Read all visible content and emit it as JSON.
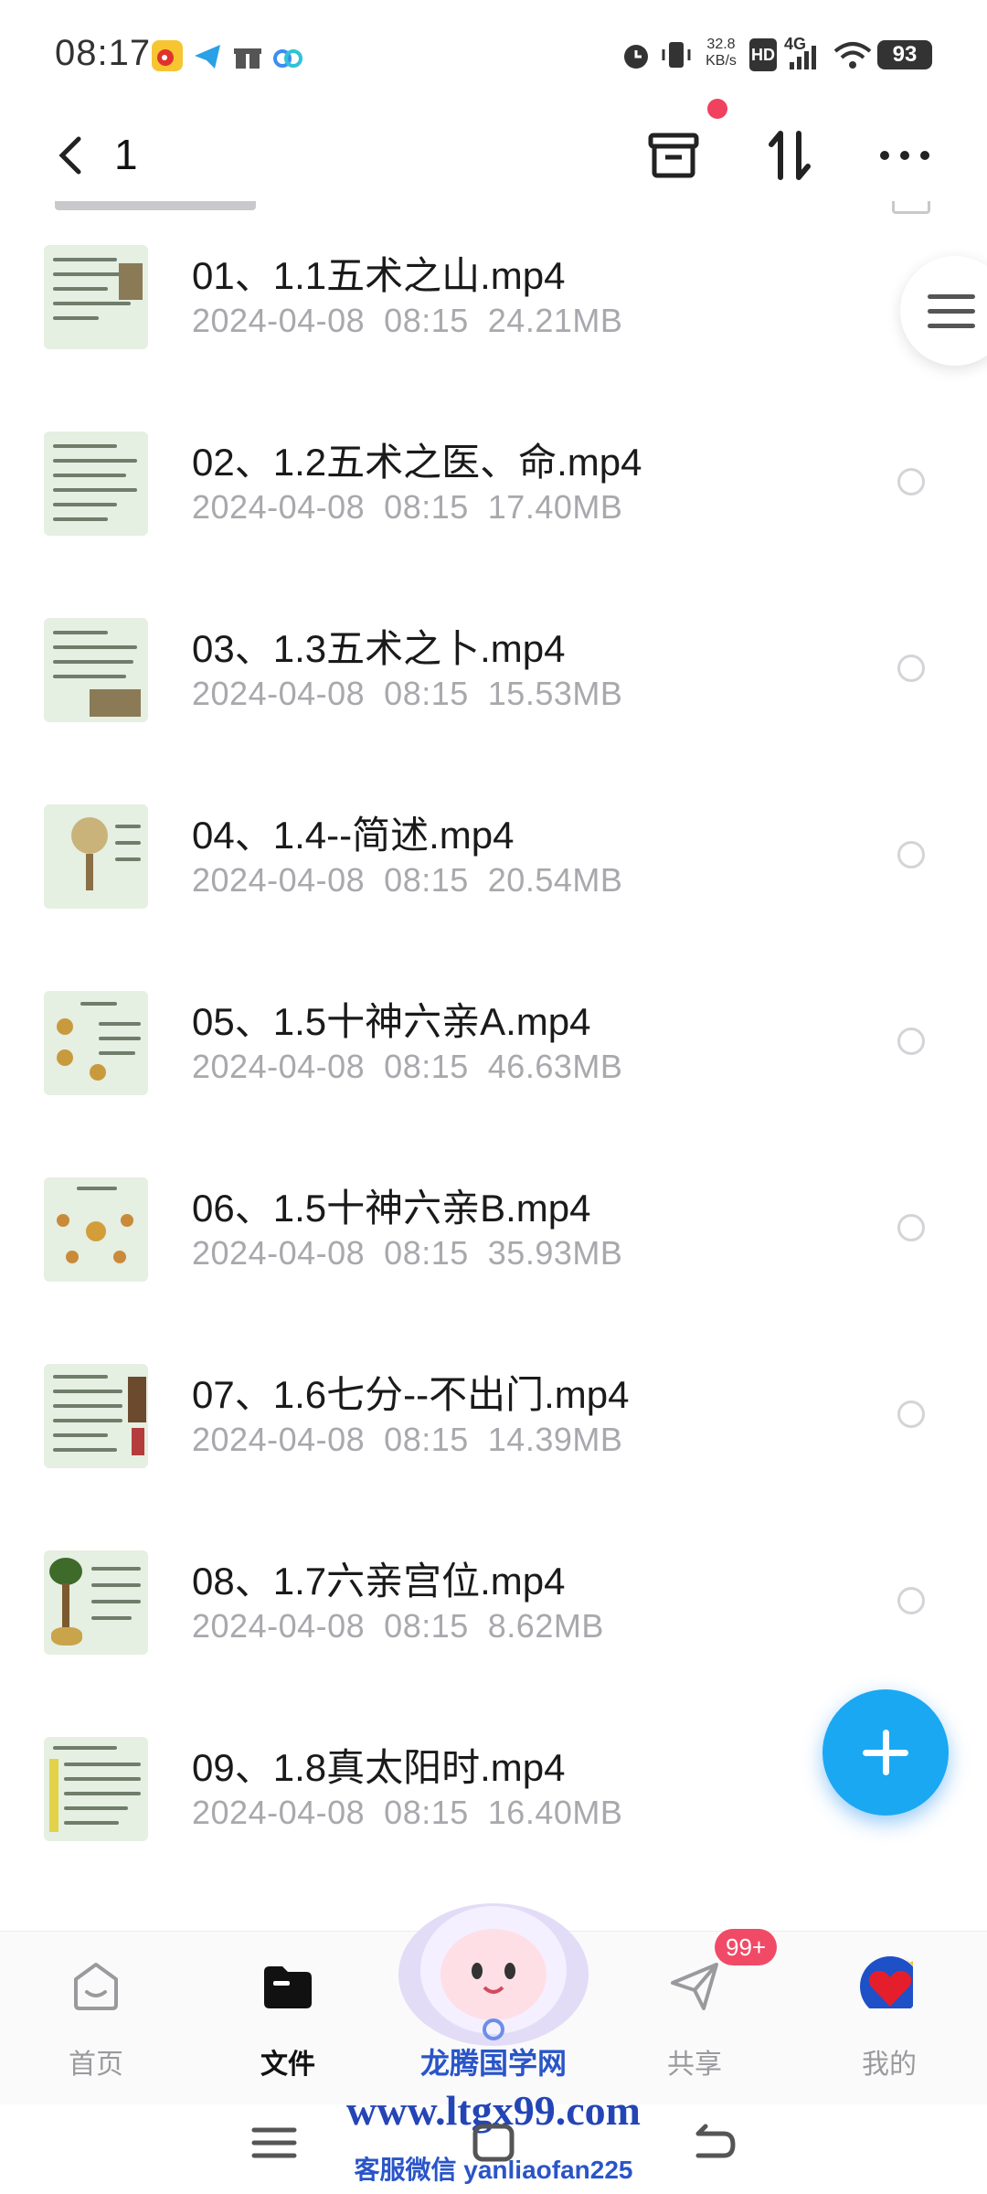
{
  "status_bar": {
    "time": "08:17",
    "net_speed_value": "32.8",
    "net_speed_unit": "KB/s",
    "hd_label": "HD",
    "network_label": "4G",
    "battery": "93"
  },
  "header": {
    "back_label": "<",
    "title": "1"
  },
  "files": [
    {
      "name": "01、1.1五术之山.mp4",
      "date": "2024-04-08",
      "time": "08:15",
      "size": "24.21MB"
    },
    {
      "name": "02、1.2五术之医、命.mp4",
      "date": "2024-04-08",
      "time": "08:15",
      "size": "17.40MB"
    },
    {
      "name": "03、1.3五术之卜.mp4",
      "date": "2024-04-08",
      "time": "08:15",
      "size": "15.53MB"
    },
    {
      "name": "04、1.4--简述.mp4",
      "date": "2024-04-08",
      "time": "08:15",
      "size": "20.54MB"
    },
    {
      "name": "05、1.5十神六亲A.mp4",
      "date": "2024-04-08",
      "time": "08:15",
      "size": "46.63MB"
    },
    {
      "name": "06、1.5十神六亲B.mp4",
      "date": "2024-04-08",
      "time": "08:15",
      "size": "35.93MB"
    },
    {
      "name": "07、1.6七分--不出门.mp4",
      "date": "2024-04-08",
      "time": "08:15",
      "size": "14.39MB"
    },
    {
      "name": "08、1.7六亲宫位.mp4",
      "date": "2024-04-08",
      "time": "08:15",
      "size": "8.62MB"
    },
    {
      "name": "09、1.8真太阳时.mp4",
      "date": "2024-04-08",
      "time": "08:15",
      "size": "16.40MB"
    }
  ],
  "tabs": [
    {
      "label": "首页",
      "icon": "home-icon"
    },
    {
      "label": "文件",
      "icon": "folder-icon"
    },
    {
      "label": "共享",
      "icon": "share-icon"
    },
    {
      "label": "我的",
      "icon": "profile-icon"
    }
  ],
  "share_badge": "99+",
  "watermark": {
    "line1": "龙腾国学网",
    "line2": "www.ltgx99.com",
    "line3": "客服微信 yanliaofan225"
  },
  "colors": {
    "accent": "#1aa8f2",
    "badge": "#f04a67",
    "meta_text": "#a8a8ad"
  }
}
